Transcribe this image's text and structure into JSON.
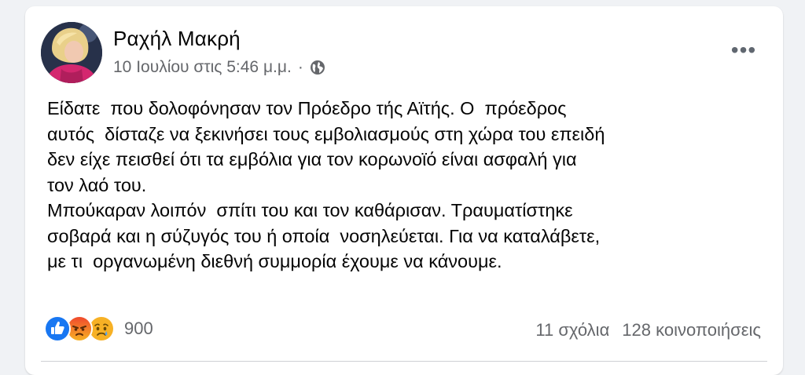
{
  "post": {
    "author": "Ραχήλ Μακρή",
    "timestamp": "10 Ιουλίου στις 5:46 μ.μ.",
    "separator": "·",
    "privacy_icon": "globe-icon",
    "more_label": "•••",
    "paragraphs": [
      "Είδατε  που δολοφόνησαν τον Πρόεδρο τής Αϊτής. Ο  πρόεδρος\nαυτός  δίσταζε να ξεκινήσει τους εμβολιασμούς στη χώρα του επειδή\nδεν είχε πεισθεί ότι τα εμβόλια για τον κορωνοϊό είναι ασφαλή για\nτον λαό του.",
      "Μπούκαραν λοιπόν  σπίτι του και τον καθάρισαν. Τραυματίστηκε\nσοβαρά και η σύζυγός του ή οποία  νοσηλεύεται. Για να καταλάβετε,\nμε τι  οργανωμένη διεθνή συμμορία έχουμε να κάνουμε."
    ]
  },
  "reactions": {
    "icons": [
      "like-icon",
      "angry-icon",
      "sad-icon"
    ],
    "count": "900"
  },
  "stats": {
    "comments": "11 σχόλια",
    "shares": "128 κοινοποιήσεις"
  },
  "colors": {
    "like": "#1877f2",
    "angry": "#e9710f",
    "sad": "#f7b125",
    "secondary_text": "#65676b"
  }
}
